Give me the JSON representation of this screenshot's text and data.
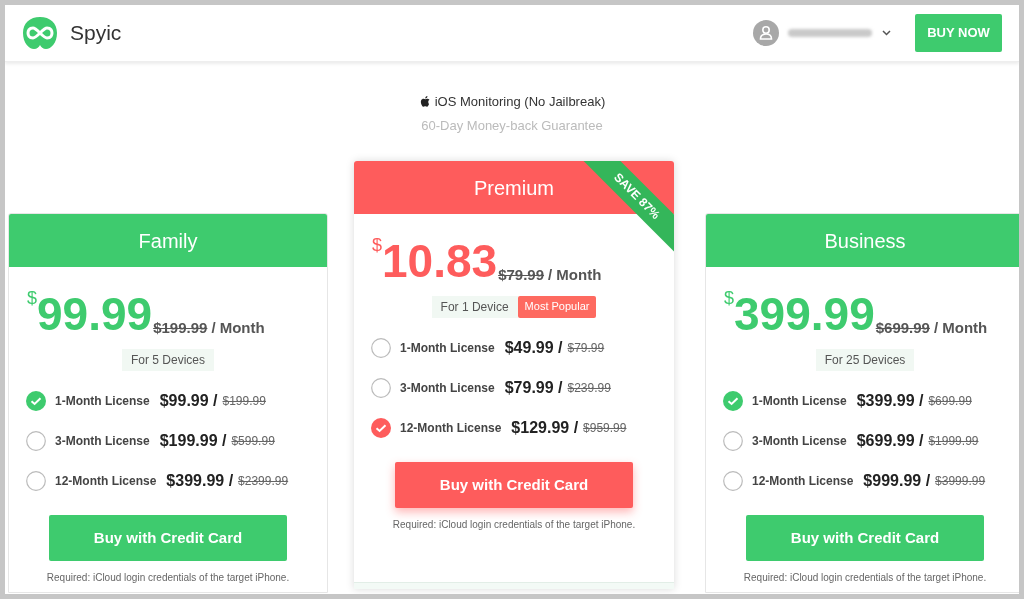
{
  "header": {
    "logo_text": "Spyic",
    "buy_button": "BUY NOW"
  },
  "intro": {
    "title": "iOS Monitoring (No Jailbreak)",
    "subtitle": "60-Day Money-back Guarantee"
  },
  "plans": [
    {
      "name": "Family",
      "color": "#3ecb6e",
      "featured": false,
      "currency": "$",
      "amount": "99.99",
      "old_price": "$199.99",
      "period": "/ Month",
      "devices": "For 5 Devices",
      "options": [
        {
          "label": "1-Month License",
          "price": "$99.99 /",
          "old_price": "$199.99",
          "selected": true
        },
        {
          "label": "3-Month License",
          "price": "$199.99 /",
          "old_price": "$599.99",
          "selected": false
        },
        {
          "label": "12-Month License",
          "price": "$399.99 /",
          "old_price": "$2399.99",
          "selected": false
        }
      ],
      "button": "Buy with Credit Card",
      "note": "Required: iCloud login credentials of the target iPhone."
    },
    {
      "name": "Premium",
      "color": "#fe5c5c",
      "featured": true,
      "ribbon": "SAVE 87%",
      "currency": "$",
      "amount": "10.83",
      "old_price": "$79.99",
      "period": "/ Month",
      "devices": "For 1 Device",
      "badge": "Most Popular",
      "options": [
        {
          "label": "1-Month License",
          "price": "$49.99 /",
          "old_price": "$79.99",
          "selected": false
        },
        {
          "label": "3-Month License",
          "price": "$79.99 /",
          "old_price": "$239.99",
          "selected": false
        },
        {
          "label": "12-Month License",
          "price": "$129.99 /",
          "old_price": "$959.99",
          "selected": true
        }
      ],
      "button": "Buy with Credit Card",
      "note": "Required: iCloud login credentials of the target iPhone."
    },
    {
      "name": "Business",
      "color": "#3ecb6e",
      "featured": false,
      "currency": "$",
      "amount": "399.99",
      "old_price": "$699.99",
      "period": "/ Month",
      "devices": "For 25 Devices",
      "options": [
        {
          "label": "1-Month License",
          "price": "$399.99 /",
          "old_price": "$699.99",
          "selected": true
        },
        {
          "label": "3-Month License",
          "price": "$699.99 /",
          "old_price": "$1999.99",
          "selected": false
        },
        {
          "label": "12-Month License",
          "price": "$999.99 /",
          "old_price": "$3999.99",
          "selected": false
        }
      ],
      "button": "Buy with Credit Card",
      "note": "Required: iCloud login credentials of the target iPhone."
    }
  ]
}
